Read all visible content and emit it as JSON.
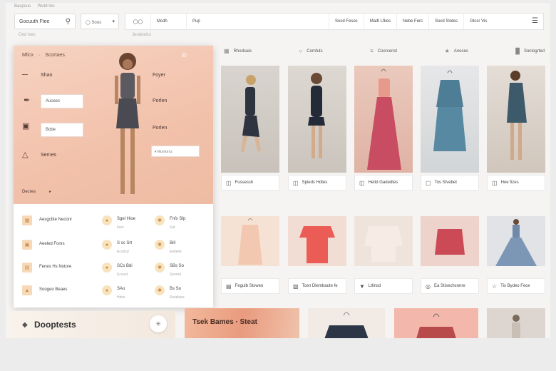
{
  "breadcrumb": [
    "Bacpcus",
    "Wutd Ion"
  ],
  "search": {
    "value": "Gocuuth Ftee"
  },
  "dropdown": {
    "label": "Sous"
  },
  "sublabels": {
    "left": "Ced Ises",
    "center": "Jeudoeics"
  },
  "topnav": {
    "items": [
      "Mcdh",
      "Pup",
      "Sosd Fesos",
      "Madt Lfkes",
      "Nebe Fers",
      "Socd Slotes",
      "Gtcsr Vis"
    ]
  },
  "categories": [
    "Rhodsuie",
    "Comfuts",
    "Coorcenst",
    "Anoces",
    "Sonlogrted"
  ],
  "row1_captions": [
    {
      "icon": "bag-icon",
      "label": "Fussessh"
    },
    {
      "icon": "bag-icon",
      "label": "Spieds Hdtes"
    },
    {
      "icon": "bag-icon",
      "label": "Heitd Gadedtes"
    },
    {
      "icon": "tag-icon",
      "label": "Tos Stvebet"
    },
    {
      "icon": "bag-icon",
      "label": "Hoe fizes"
    }
  ],
  "row2_captions": [
    {
      "icon": "doc-icon",
      "label": "Fegulb Stsweo"
    },
    {
      "icon": "car-icon",
      "label": "Tcen Dlembaute fe"
    },
    {
      "icon": "shoe-icon",
      "label": "Ltlinsd"
    },
    {
      "icon": "pin-icon",
      "label": "Ea Stisechsnnre"
    },
    {
      "icon": "star-icon",
      "label": "Tis Bydeo Fece"
    }
  ],
  "overlay": {
    "header": [
      "Mlicx",
      "Scortaes"
    ],
    "left_items": [
      {
        "icon": "hat-icon",
        "label": "Shao"
      },
      {
        "icon": "pencil-icon",
        "label": "Aucees"
      },
      {
        "icon": "camera-icon",
        "label": "Bobe"
      },
      {
        "icon": "hanger-icon",
        "label": "Sernes"
      }
    ],
    "right_items": [
      "Foyer",
      "Porlen",
      "Porlen"
    ],
    "select": "Munrorcs",
    "footer_label": "Decres",
    "list_col1": [
      {
        "label": "Aesgcbte Neconr",
        "sub": ""
      },
      {
        "label": "Aeeled Fonrs",
        "sub": ""
      },
      {
        "label": "Fenes Hs Notore",
        "sub": ""
      },
      {
        "label": "Soogeo Beaes",
        "sub": ""
      }
    ],
    "list_col2": [
      {
        "label": "Sgel Hioe",
        "sub": "Ines"
      },
      {
        "label": "S sc Srt",
        "sub": "Ecorlsd"
      },
      {
        "label": "SCs Bdi",
        "sub": "Ecsunt"
      },
      {
        "label": "SAo",
        "sub": "Hdcs"
      }
    ],
    "list_col3": [
      {
        "label": "Fnfs Sfp",
        "sub": "Sut"
      },
      {
        "label": "Bill",
        "sub": "Eeitebe"
      },
      {
        "label": "SBs So",
        "sub": "Sonrod"
      },
      {
        "label": "Bs So",
        "sub": "Sosdiaes"
      }
    ]
  },
  "dash": {
    "title": "Dooptests"
  },
  "promo": {
    "text": "Tsek Bames · Steat"
  },
  "colors": {
    "accent": "#f2c1aa",
    "panel": "#ffffff",
    "bg": "#f6f4f2"
  }
}
